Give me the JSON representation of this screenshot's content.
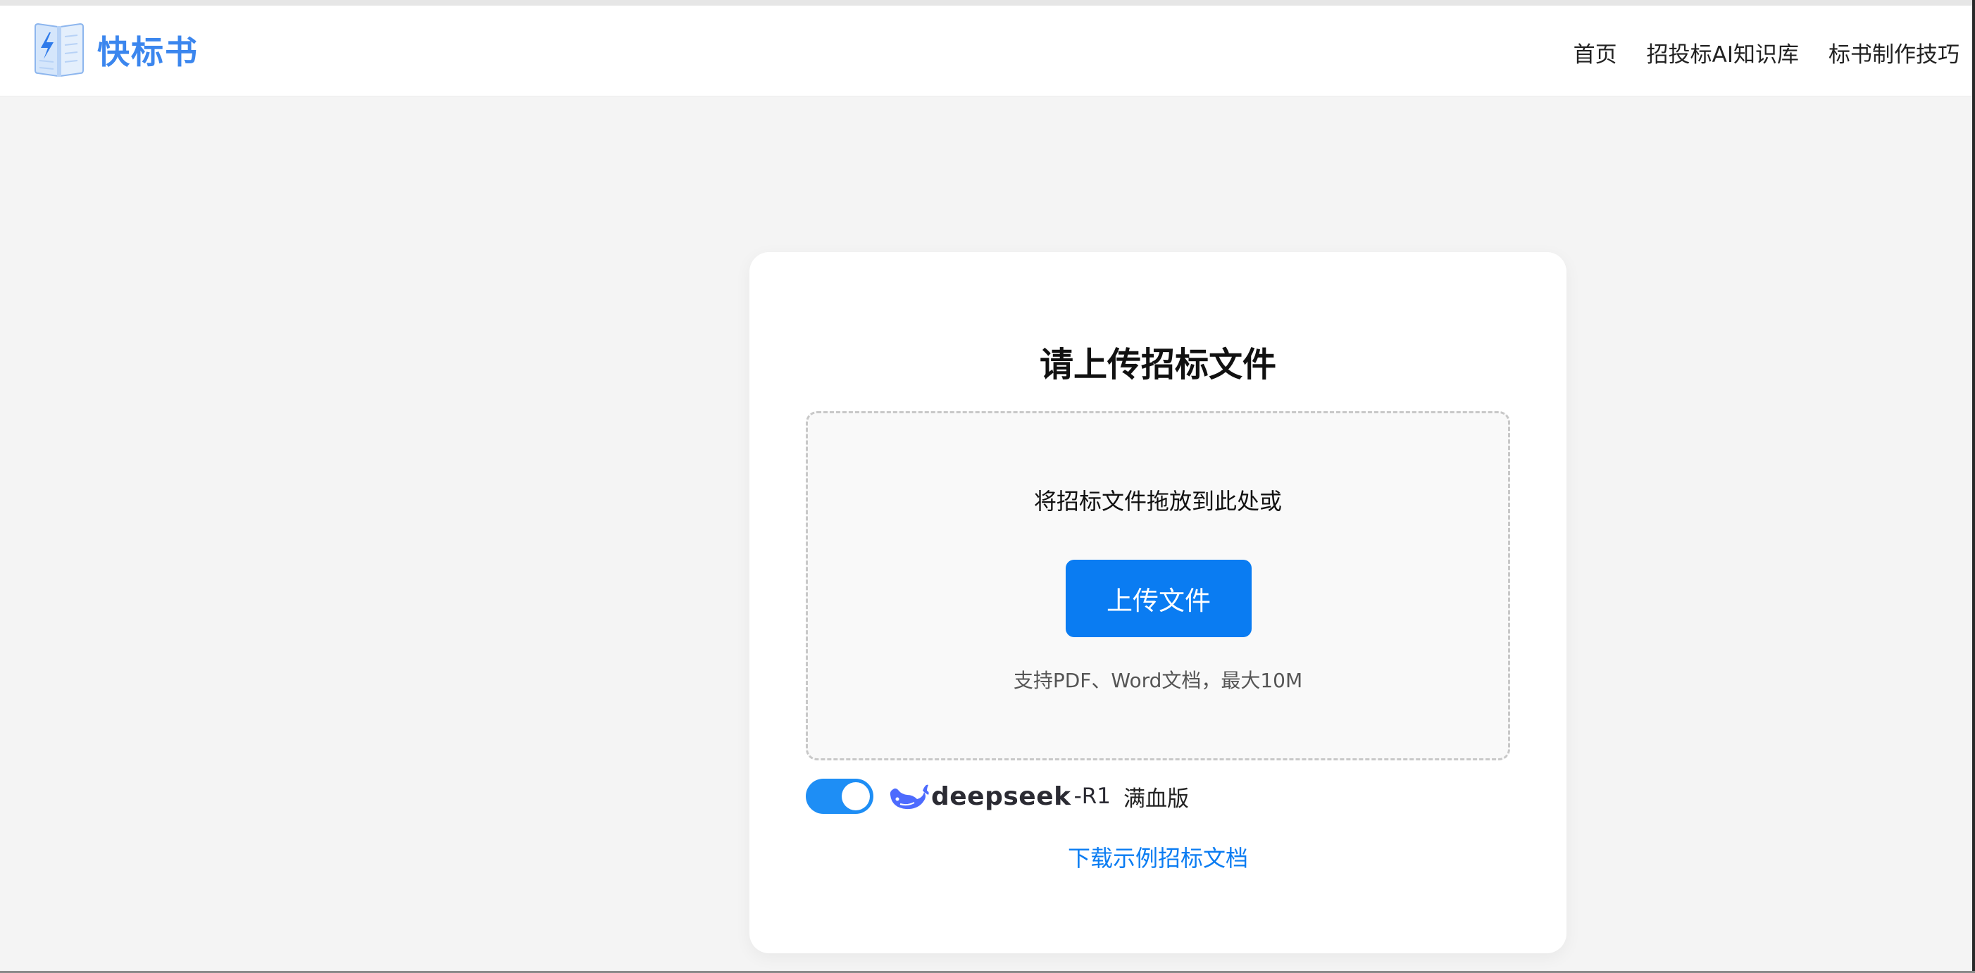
{
  "header": {
    "logo_text": "快标书",
    "nav": [
      {
        "label": "首页"
      },
      {
        "label": "招投标AI知识库"
      },
      {
        "label": "标书制作技巧"
      }
    ]
  },
  "upload_card": {
    "title": "请上传招标文件",
    "dropzone_text": "将招标文件拖放到此处或",
    "upload_button_label": "上传文件",
    "hint": "支持PDF、Word文档，最大10M",
    "model_toggle": {
      "on": true,
      "brand": "deepseek",
      "variant": "-R1",
      "suffix": "满血版"
    },
    "download_link": "下载示例招标文档"
  },
  "colors": {
    "brand_blue": "#3b86ee",
    "button_blue": "#0a7cf2",
    "toggle_blue": "#1e8ef5",
    "whale_blue": "#4d6bfe"
  },
  "icons": {
    "logo": "book-lightning-icon",
    "model": "deepseek-whale-icon"
  }
}
